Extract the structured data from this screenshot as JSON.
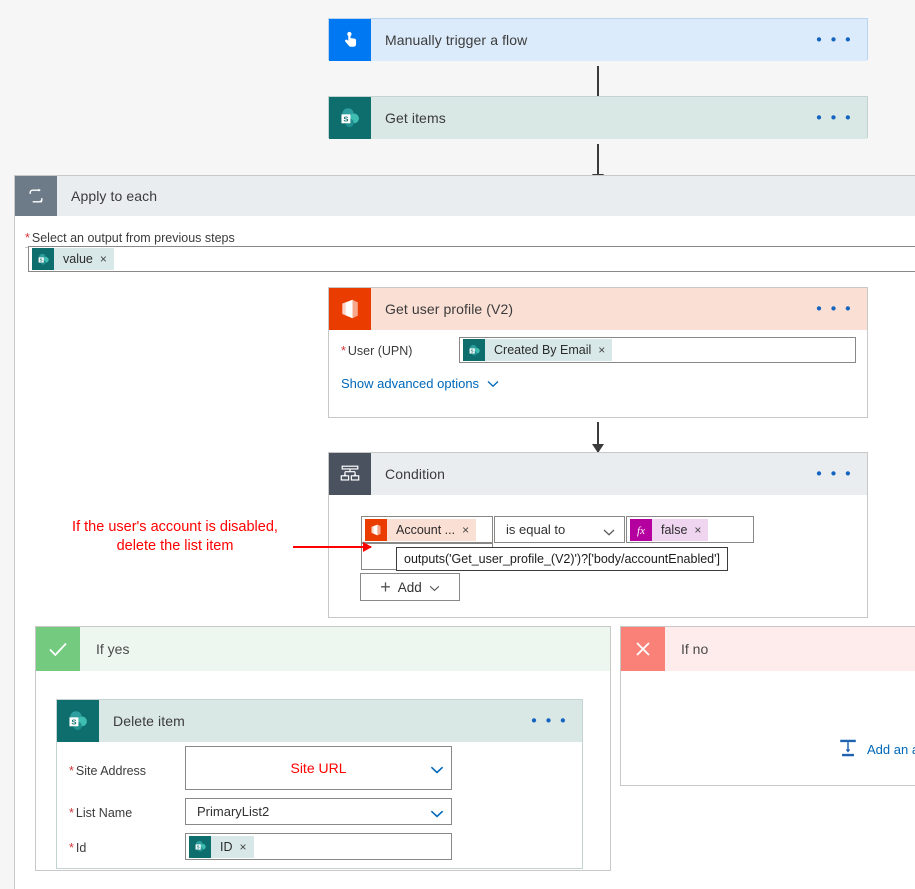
{
  "flow": {
    "trigger": {
      "title": "Manually trigger a flow",
      "icon": "touch-trigger-icon",
      "header_bg": "#dcebfb",
      "icon_bg": "#0078f2",
      "menu": "• • •"
    },
    "get_items": {
      "title": "Get items",
      "icon": "sharepoint-icon",
      "header_bg": "#d9e7e5",
      "icon_bg": "#0e6e6e",
      "menu": "• • •"
    },
    "apply_to_each": {
      "title": "Apply to each",
      "icon": "loop-icon",
      "header_bg": "#e9edf0",
      "icon_bg": "#6d7a88",
      "field_label": "Select an output from previous steps",
      "required": "*",
      "token": {
        "label": "value",
        "remove": "×",
        "icon": "sharepoint-icon"
      }
    },
    "get_user_profile": {
      "title": "Get user profile (V2)",
      "icon": "office365-icon",
      "header_bg": "#fadfd4",
      "icon_bg": "#eb3c00",
      "menu": "• • •",
      "field_label": "User (UPN)",
      "required": "*",
      "token": {
        "label": "Created By Email",
        "remove": "×",
        "icon": "sharepoint-icon"
      },
      "advanced_link": "Show advanced options"
    },
    "condition": {
      "title": "Condition",
      "icon": "condition-branch-icon",
      "header_bg": "#e9edf0",
      "icon_bg": "#4a5260",
      "menu": "• • •",
      "left_token": {
        "label": "Account ...",
        "remove": "×",
        "icon": "office365-icon"
      },
      "operator": "is equal to",
      "right_token": {
        "label": "false",
        "remove": "×",
        "icon": "fx-icon"
      },
      "tooltip": "outputs('Get_user_profile_(V2)')?['body/accountEnabled']",
      "add_button": "Add",
      "add_plus": "+"
    },
    "if_yes": {
      "title": "If yes",
      "icon": "checkmark-icon",
      "header_bg": "#eef7ef",
      "icon_bg": "#74cb80",
      "action": {
        "title": "Delete item",
        "icon": "sharepoint-icon",
        "header_bg": "#d9e7e5",
        "icon_bg": "#0e6e6e",
        "menu": "• • •",
        "fields": [
          {
            "label": "Site Address",
            "required": "*",
            "value": "Site URL",
            "kind": "dropdown",
            "value_color": "#ff0000",
            "centered": true
          },
          {
            "label": "List Name",
            "required": "*",
            "value": "PrimaryList2",
            "kind": "dropdown",
            "value_color": "#323130",
            "centered": false
          },
          {
            "label": "Id",
            "required": "*",
            "kind": "token",
            "token": {
              "label": "ID",
              "remove": "×",
              "icon": "sharepoint-icon"
            }
          }
        ]
      }
    },
    "if_no": {
      "title": "If no",
      "icon": "cross-icon",
      "header_bg": "#fdeceb",
      "icon_bg": "#f98177",
      "add_action_label": "Add an ac",
      "add_action_icon": "add-action-icon"
    }
  },
  "annotation": {
    "line1": "If the user's account is disabled,",
    "line2": "delete the list item",
    "color": "#ff0000"
  }
}
